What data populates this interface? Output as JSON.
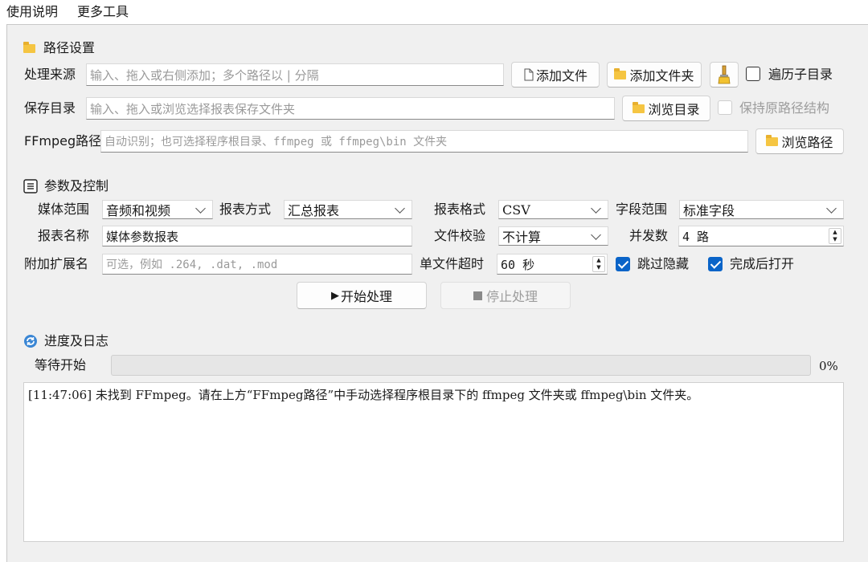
{
  "menu": {
    "usage": "使用说明",
    "more_tools": "更多工具"
  },
  "path_section": {
    "title": "路径设置",
    "source_label": "处理来源",
    "source_placeholder": "输入、拖入或右侧添加；多个路径以 | 分隔",
    "add_file": "添加文件",
    "add_folder": "添加文件夹",
    "recurse_label": "遍历子目录",
    "save_label": "保存目录",
    "save_placeholder": "输入、拖入或浏览选择报表保存文件夹",
    "browse_dir": "浏览目录",
    "keep_structure_label": "保持原路径结构",
    "ffmpeg_label": "FFmpeg路径",
    "ffmpeg_placeholder": "自动识别；也可选择程序根目录、ffmpeg 或 ffmpeg\\bin 文件夹",
    "browse_path": "浏览路径"
  },
  "params_section": {
    "title": "参数及控制",
    "media_scope_label": "媒体范围",
    "media_scope_value": "音频和视频",
    "report_mode_label": "报表方式",
    "report_mode_value": "汇总报表",
    "report_format_label": "报表格式",
    "report_format_value": "CSV",
    "field_scope_label": "字段范围",
    "field_scope_value": "标准字段",
    "report_name_label": "报表名称",
    "report_name_value": "媒体参数报表",
    "checksum_label": "文件校验",
    "checksum_value": "不计算",
    "concurrency_label": "并发数",
    "concurrency_value": "4 路",
    "extra_ext_label": "附加扩展名",
    "extra_ext_placeholder": "可选，例如 .264, .dat, .mod",
    "timeout_label": "单文件超时",
    "timeout_value": "60 秒",
    "skip_hidden_label": "跳过隐藏",
    "open_after_label": "完成后打开",
    "start_button": "开始处理",
    "stop_button": "停止处理"
  },
  "progress_section": {
    "title": "进度及日志",
    "status": "等待开始",
    "percent": "0%",
    "progress_value": 0,
    "log_line": "[11:47:06] 未找到 FFmpeg。请在上方“FFmpeg路径”中手动选择程序根目录下的 ffmpeg 文件夹或 ffmpeg\\bin 文件夹。"
  },
  "checkboxes": {
    "recurse": false,
    "keep_structure": false,
    "skip_hidden": true,
    "open_after": true
  },
  "colors": {
    "accent": "#0a64c8",
    "folder": "#f5c542",
    "panel_bg": "#f0f0f0"
  }
}
